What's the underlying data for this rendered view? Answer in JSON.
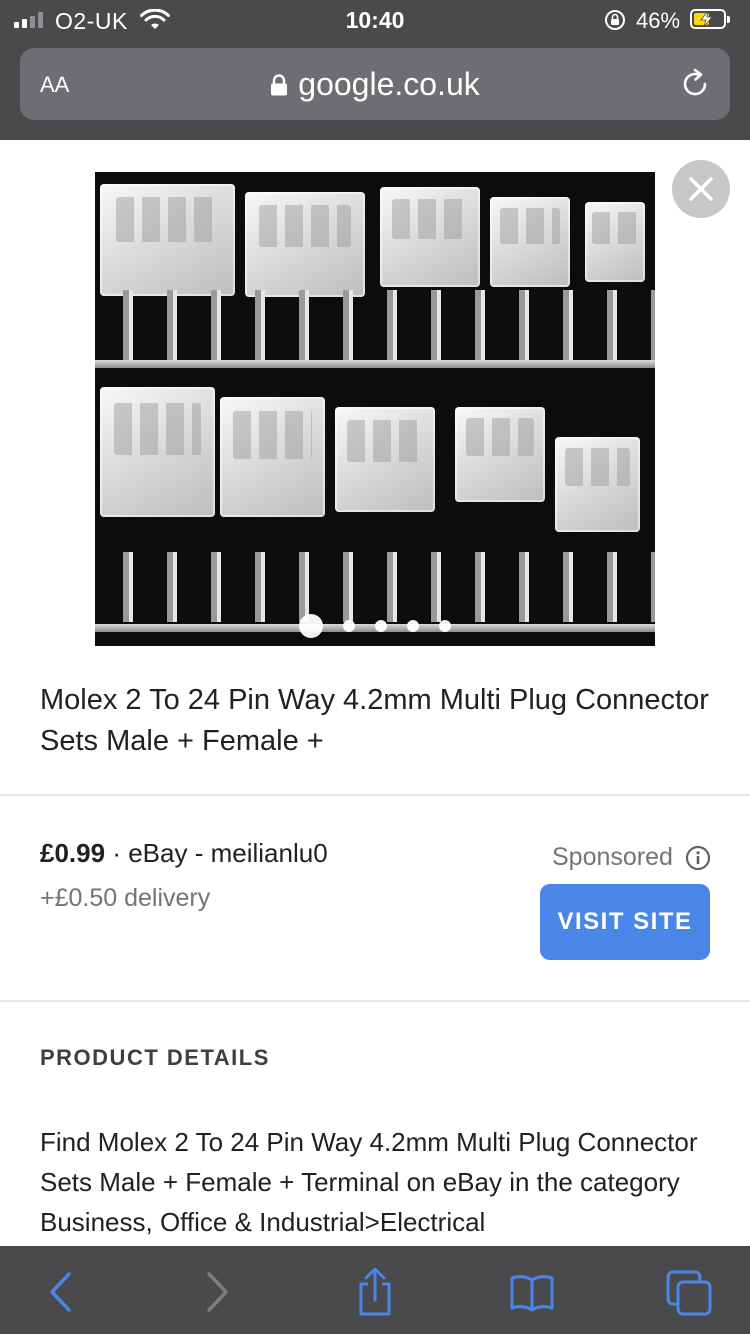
{
  "status_bar": {
    "carrier": "O2-UK",
    "time": "10:40",
    "battery_percent": "46%",
    "battery_level": 0.46,
    "icons": [
      "signal-icon",
      "wifi-icon",
      "rotation-lock-icon",
      "battery-charging-icon"
    ]
  },
  "address_bar": {
    "text_size_label": "AA",
    "url": "google.co.uk",
    "icons": [
      "lock-icon",
      "reload-icon"
    ]
  },
  "product": {
    "image_alt": "Molex connectors and crimp pins",
    "carousel_count": 5,
    "carousel_active": 1,
    "title": "Molex 2 To 24 Pin Way 4.2mm Multi Plug Connector Sets Male + Female +",
    "price": "£0.99",
    "separator": "·",
    "seller": "eBay - meilianlu0",
    "delivery": "+£0.50 delivery",
    "sponsored": "Sponsored",
    "visit_button": "VISIT SITE"
  },
  "details": {
    "heading": "PRODUCT DETAILS",
    "body": "Find Molex 2 To 24 Pin Way 4.2mm Multi Plug Connector Sets Male + Female + Terminal on eBay in the category Business, Office & Industrial>Electrical"
  },
  "toolbar": {
    "icons": [
      "back-icon",
      "forward-icon",
      "share-icon",
      "bookmarks-icon",
      "tabs-icon"
    ]
  },
  "colors": {
    "chrome": "#4a4a4c",
    "accent": "#4a86e8",
    "battery": "#ffd60a",
    "toolbar_icon": "#4a86e8"
  }
}
